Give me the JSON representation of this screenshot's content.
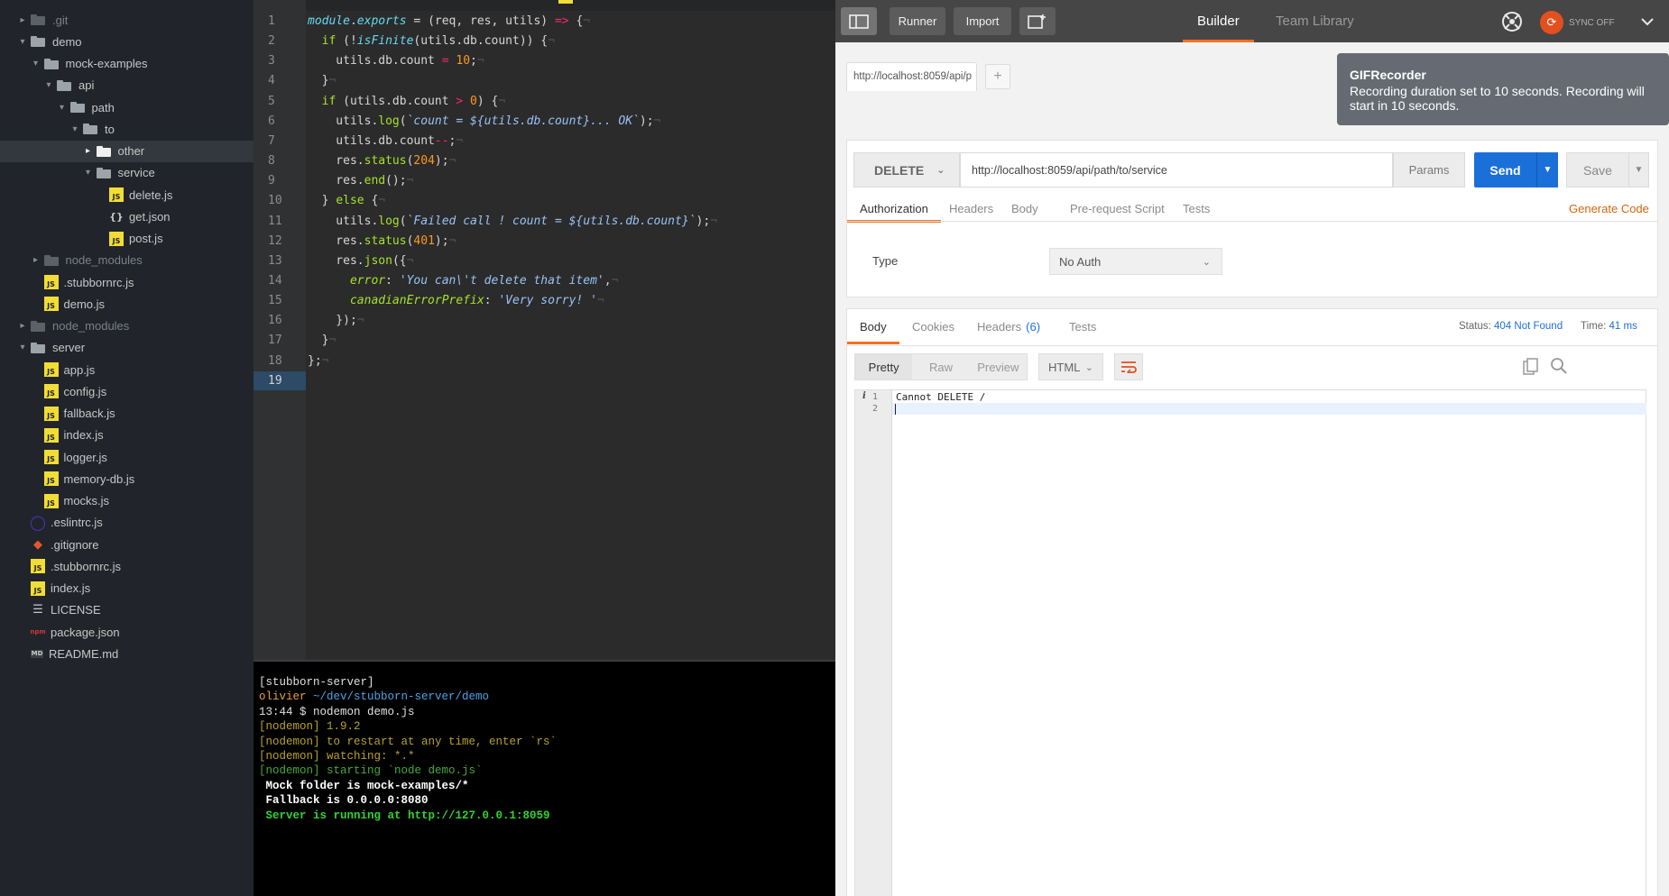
{
  "file_tree": {
    "items": [
      {
        "label": ".git",
        "type": "folder",
        "depth": 1,
        "expanded": false,
        "dim": true
      },
      {
        "label": "demo",
        "type": "folder",
        "depth": 1,
        "expanded": true
      },
      {
        "label": "mock-examples",
        "type": "folder",
        "depth": 2,
        "expanded": true
      },
      {
        "label": "api",
        "type": "folder",
        "depth": 3,
        "expanded": true
      },
      {
        "label": "path",
        "type": "folder",
        "depth": 4,
        "expanded": true
      },
      {
        "label": "to",
        "type": "folder",
        "depth": 5,
        "expanded": true
      },
      {
        "label": "other",
        "type": "folder",
        "depth": 6,
        "expanded": false,
        "selected": true
      },
      {
        "label": "service",
        "type": "folder",
        "depth": 6,
        "expanded": true
      },
      {
        "label": "delete.js",
        "type": "js",
        "depth": 7
      },
      {
        "label": "get.json",
        "type": "json",
        "depth": 7
      },
      {
        "label": "post.js",
        "type": "js",
        "depth": 7
      },
      {
        "label": "node_modules",
        "type": "folder",
        "depth": 2,
        "expanded": false,
        "dim": true
      },
      {
        "label": ".stubbornrc.js",
        "type": "js",
        "depth": 2
      },
      {
        "label": "demo.js",
        "type": "js",
        "depth": 2
      },
      {
        "label": "node_modules",
        "type": "folder",
        "depth": 1,
        "expanded": false,
        "dim": true
      },
      {
        "label": "server",
        "type": "folder",
        "depth": 1,
        "expanded": true
      },
      {
        "label": "app.js",
        "type": "js",
        "depth": 2
      },
      {
        "label": "config.js",
        "type": "js",
        "depth": 2
      },
      {
        "label": "fallback.js",
        "type": "js",
        "depth": 2
      },
      {
        "label": "index.js",
        "type": "js",
        "depth": 2
      },
      {
        "label": "logger.js",
        "type": "js",
        "depth": 2
      },
      {
        "label": "memory-db.js",
        "type": "js",
        "depth": 2
      },
      {
        "label": "mocks.js",
        "type": "js",
        "depth": 2
      },
      {
        "label": ".eslintrc.js",
        "type": "eslint",
        "depth": 1
      },
      {
        "label": ".gitignore",
        "type": "git",
        "depth": 1
      },
      {
        "label": ".stubbornrc.js",
        "type": "js",
        "depth": 1
      },
      {
        "label": "index.js",
        "type": "js",
        "depth": 1
      },
      {
        "label": "LICENSE",
        "type": "license",
        "depth": 1
      },
      {
        "label": "package.json",
        "type": "npm",
        "depth": 1
      },
      {
        "label": "README.md",
        "type": "md",
        "depth": 1
      }
    ]
  },
  "editor": {
    "active_line": 19,
    "line_numbers": [
      "1",
      "2",
      "3",
      "4",
      "5",
      "6",
      "7",
      "8",
      "9",
      "10",
      "11",
      "12",
      "13",
      "14",
      "15",
      "16",
      "17",
      "18",
      "19"
    ],
    "lines": [
      [
        [
          "it",
          "module"
        ],
        [
          "pun",
          "."
        ],
        [
          "it",
          "exports"
        ],
        [
          "pun",
          " = (req, res, utils) "
        ],
        [
          "op",
          "=>"
        ],
        [
          "pun",
          " {"
        ],
        [
          "inv",
          "¬"
        ]
      ],
      [
        [
          "pun",
          "  "
        ],
        [
          "kw",
          "if"
        ],
        [
          "pun",
          " (!"
        ],
        [
          "it",
          "isFinite"
        ],
        [
          "pun",
          "(utils.db.count)) {"
        ],
        [
          "inv",
          "¬"
        ]
      ],
      [
        [
          "pun",
          "    utils.db.count "
        ],
        [
          "op",
          "="
        ],
        [
          "pun",
          " "
        ],
        [
          "num",
          "10"
        ],
        [
          "pun",
          ";"
        ],
        [
          "inv",
          "¬"
        ]
      ],
      [
        [
          "pun",
          "  }"
        ],
        [
          "inv",
          "¬"
        ]
      ],
      [
        [
          "pun",
          "  "
        ],
        [
          "kw",
          "if"
        ],
        [
          "pun",
          " (utils.db.count "
        ],
        [
          "op",
          ">"
        ],
        [
          "pun",
          " "
        ],
        [
          "num",
          "0"
        ],
        [
          "pun",
          ") {"
        ],
        [
          "inv",
          "¬"
        ]
      ],
      [
        [
          "pun",
          "    utils."
        ],
        [
          "fn",
          "log"
        ],
        [
          "pun",
          "("
        ],
        [
          "str",
          "`count = ${utils.db.count}... OK`"
        ],
        [
          "pun",
          ");"
        ],
        [
          "inv",
          "¬"
        ]
      ],
      [
        [
          "pun",
          "    utils.db.count"
        ],
        [
          "op",
          "--"
        ],
        [
          "pun",
          ";"
        ],
        [
          "inv",
          "¬"
        ]
      ],
      [
        [
          "pun",
          "    res."
        ],
        [
          "fn",
          "status"
        ],
        [
          "pun",
          "("
        ],
        [
          "num",
          "204"
        ],
        [
          "pun",
          ");"
        ],
        [
          "inv",
          "¬"
        ]
      ],
      [
        [
          "pun",
          "    res."
        ],
        [
          "fn",
          "end"
        ],
        [
          "pun",
          "();"
        ],
        [
          "inv",
          "¬"
        ]
      ],
      [
        [
          "pun",
          "  } "
        ],
        [
          "kw",
          "else"
        ],
        [
          "pun",
          " {"
        ],
        [
          "inv",
          "¬"
        ]
      ],
      [
        [
          "pun",
          "    utils."
        ],
        [
          "fn",
          "log"
        ],
        [
          "pun",
          "("
        ],
        [
          "str",
          "`Failed call ! count = ${utils.db.count}`"
        ],
        [
          "pun",
          ");"
        ],
        [
          "inv",
          "¬"
        ]
      ],
      [
        [
          "pun",
          "    res."
        ],
        [
          "fn",
          "status"
        ],
        [
          "pun",
          "("
        ],
        [
          "num",
          "401"
        ],
        [
          "pun",
          ");"
        ],
        [
          "inv",
          "¬"
        ]
      ],
      [
        [
          "pun",
          "    res."
        ],
        [
          "fn",
          "json"
        ],
        [
          "pun",
          "({"
        ],
        [
          "inv",
          "¬"
        ]
      ],
      [
        [
          "pun",
          "      "
        ],
        [
          "prop",
          "error"
        ],
        [
          "pun",
          ": "
        ],
        [
          "str",
          "'You can\\'t delete that item'"
        ],
        [
          "pun",
          ","
        ],
        [
          "inv",
          "¬"
        ]
      ],
      [
        [
          "pun",
          "      "
        ],
        [
          "prop",
          "canadianErrorPrefix"
        ],
        [
          "pun",
          ": "
        ],
        [
          "str",
          "'Very sorry! '"
        ],
        [
          "inv",
          "¬"
        ]
      ],
      [
        [
          "pun",
          "    });"
        ],
        [
          "inv",
          "¬"
        ]
      ],
      [
        [
          "pun",
          "  }"
        ],
        [
          "inv",
          "¬"
        ]
      ],
      [
        [
          "pun",
          "};"
        ],
        [
          "inv",
          "¬"
        ]
      ],
      []
    ]
  },
  "terminal": {
    "lines": [
      {
        "cls": "t-white",
        "text": "[stubborn-server]"
      },
      {
        "parts": [
          {
            "cls": "t-orange",
            "text": "olivier "
          },
          {
            "cls": "t-blue",
            "text": "~/dev/stubborn-server/demo"
          }
        ]
      },
      {
        "cls": "t-white",
        "text": "13:44 $ nodemon demo.js"
      },
      {
        "cls": "t-yellow",
        "text": "[nodemon] 1.9.2"
      },
      {
        "cls": "t-yellow",
        "text": "[nodemon] to restart at any time, enter `rs`"
      },
      {
        "cls": "t-yellow",
        "text": "[nodemon] watching: *.*"
      },
      {
        "cls": "t-green",
        "text": "[nodemon] starting `node demo.js`"
      },
      {
        "cls": "t-bold",
        "text": " Mock folder is mock-examples/*"
      },
      {
        "cls": "t-bold",
        "text": " Fallback is 0.0.0.0:8080"
      },
      {
        "cls": "t-bold-green",
        "text": " Server is running at http://127.0.0.1:8059"
      }
    ]
  },
  "postman": {
    "header": {
      "runner_label": "Runner",
      "import_label": "Import",
      "builder_tab": "Builder",
      "team_library_tab": "Team Library",
      "sync_label": "SYNC OFF"
    },
    "request_tab_label": "http://localhost:8059/api/p",
    "method": "DELETE",
    "url": "http://localhost:8059/api/path/to/service",
    "params_label": "Params",
    "send_label": "Send",
    "save_label": "Save",
    "request_subtabs": [
      "Authorization",
      "Headers",
      "Body",
      "Pre-request Script",
      "Tests"
    ],
    "generate_code_label": "Generate Code",
    "auth": {
      "type_label": "Type",
      "value": "No Auth"
    },
    "response_tabs": {
      "body": "Body",
      "cookies": "Cookies",
      "headers": "Headers",
      "headers_count": "(6)",
      "tests": "Tests"
    },
    "status_label": "Status:",
    "status_value": "404 Not Found",
    "time_label": "Time:",
    "time_value": "41 ms",
    "format_buttons": [
      "Pretty",
      "Raw",
      "Preview"
    ],
    "format_select": "HTML",
    "response_lines": [
      "Cannot DELETE /",
      ""
    ],
    "response_line_numbers": [
      "1",
      "2"
    ],
    "colors": {
      "accent": "#f47023",
      "send": "#1b6fd9",
      "status": "#1b6fd9"
    }
  },
  "toast": {
    "title": "GIFRecorder",
    "message": "Recording duration set to 10 seconds. Recording will start in 10 seconds."
  }
}
